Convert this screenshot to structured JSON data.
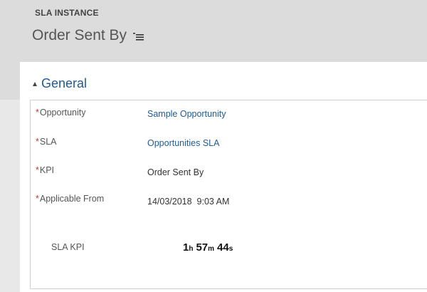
{
  "header": {
    "entity_type": "SLA INSTANCE",
    "record_title": "Order Sent By",
    "menu_icon": "list-menu-icon"
  },
  "section": {
    "title": "General",
    "collapse_icon": "triangle-up-icon"
  },
  "fields": {
    "opportunity": {
      "label": "Opportunity",
      "value": "Sample Opportunity",
      "required": true
    },
    "sla": {
      "label": "SLA",
      "value": "Opportunities SLA",
      "required": true
    },
    "kpi": {
      "label": "KPI",
      "value": "Order Sent By",
      "required": true
    },
    "applicable_from": {
      "label": "Applicable From",
      "date": "14/03/2018",
      "time": "9:03 AM",
      "required": true
    },
    "sla_kpi": {
      "label": "SLA KPI",
      "hours": "1",
      "hours_unit": "h",
      "minutes": "57",
      "minutes_unit": "m",
      "seconds": "44",
      "seconds_unit": "s"
    }
  },
  "colors": {
    "link": "#1f5a96",
    "required_marker": "#c0392b",
    "header_background": "#dcdcdc"
  }
}
